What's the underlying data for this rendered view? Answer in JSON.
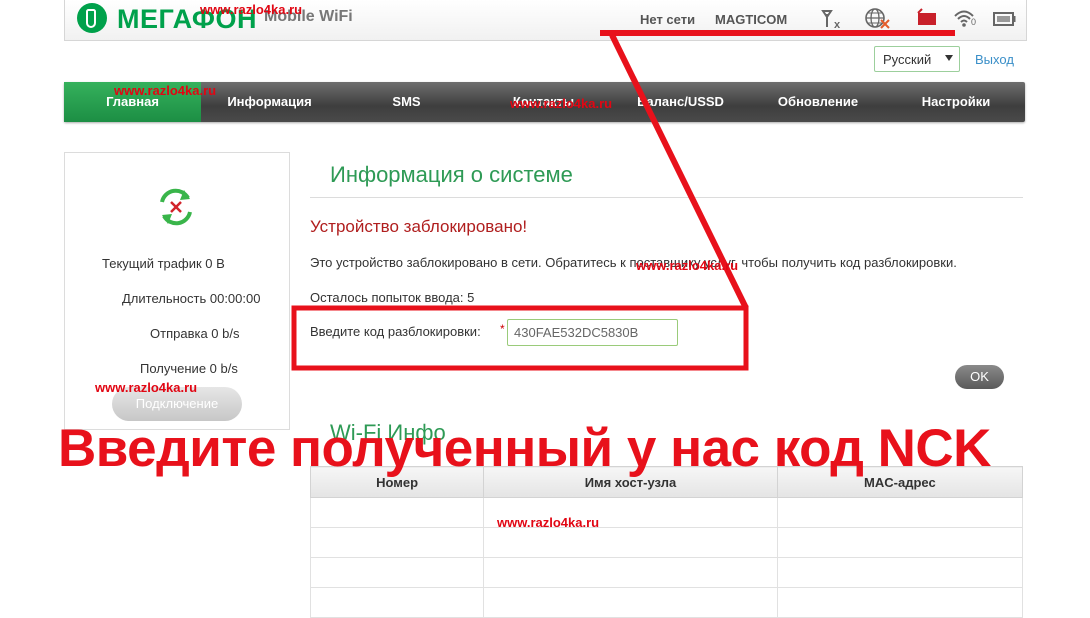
{
  "header": {
    "logo_text": "МЕГАФОН",
    "logo_subtitle": "Mobile WiFi",
    "network_status": "Нет сети",
    "operator": "MAGTICOM",
    "wifi_clients": "0"
  },
  "toolbar": {
    "language": "Русский",
    "logout_label": "Выход"
  },
  "nav": {
    "items": [
      {
        "label": "Главная"
      },
      {
        "label": "Информация"
      },
      {
        "label": "SMS"
      },
      {
        "label": "Контакты"
      },
      {
        "label": "Баланс/USSD"
      },
      {
        "label": "Обновление"
      },
      {
        "label": "Настройки"
      }
    ]
  },
  "left_panel": {
    "traffic": "Текущий трафик 0 B",
    "duration": "Длительность 00:00:00",
    "upload": "Отправка 0 b/s",
    "download": "Получение 0 b/s",
    "connect_label": "Подключение"
  },
  "system_info": {
    "title": "Информация о системе",
    "locked_title": "Устройство заблокировано!",
    "message": "Это устройство заблокировано в сети. Обратитесь к поставщику услуг, чтобы получить код разблокировки.",
    "attempts": "Осталось попыток ввода: 5",
    "code_label": "Введите код разблокировки:",
    "required_mark": "*",
    "code_value": "430FAE532DC5830B",
    "ok_label": "OK"
  },
  "wifi_info": {
    "title": "Wi-Fi Инфо",
    "columns": [
      "Номер",
      "Имя хост-узла",
      "MAC-адрес"
    ],
    "rows": 4
  },
  "overlay": {
    "watermark": "www.razlo4ka.ru",
    "banner": "Введите полученный у нас код NCK",
    "color": "#e8111b"
  }
}
